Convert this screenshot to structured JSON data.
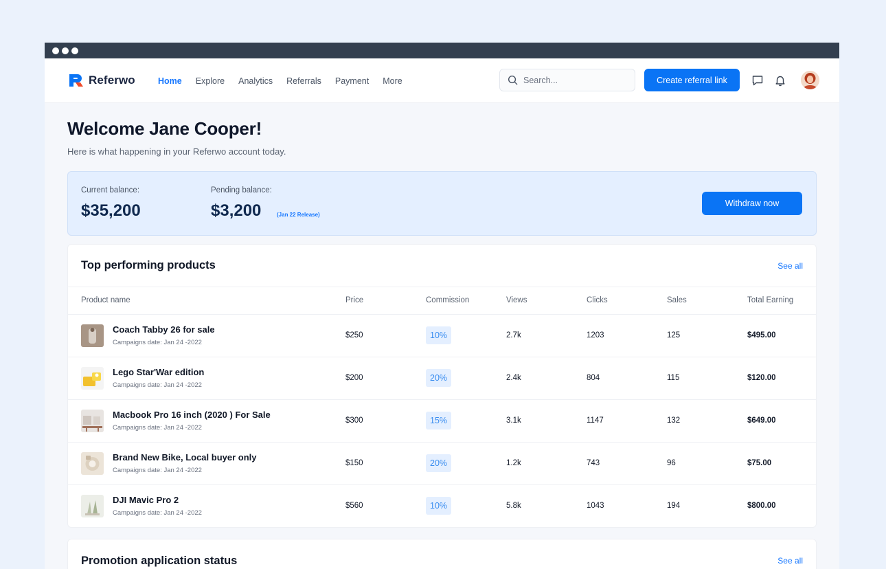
{
  "brand": {
    "name": "Referwo",
    "primary_color": "#0a74f5",
    "accent_red": "#f04a2a"
  },
  "nav": {
    "items": [
      {
        "label": "Home",
        "active": true
      },
      {
        "label": "Explore",
        "active": false
      },
      {
        "label": "Analytics",
        "active": false
      },
      {
        "label": "Referrals",
        "active": false
      },
      {
        "label": "Payment",
        "active": false
      },
      {
        "label": "More",
        "active": false
      }
    ]
  },
  "search": {
    "placeholder": "Search...",
    "icon": "search-icon"
  },
  "header_actions": {
    "create_label": "Create referral link",
    "icons": [
      "message-icon",
      "bell-icon"
    ]
  },
  "welcome": {
    "title": "Welcome Jane Cooper!",
    "subtitle": "Here is what happening in your Referwo account today."
  },
  "balance": {
    "current_label": "Current balance:",
    "current_value": "$35,200",
    "pending_label": "Pending balance:",
    "pending_value": "$3,200",
    "pending_note": "(Jan 22 Release)",
    "withdraw_label": "Withdraw now"
  },
  "products": {
    "title": "Top performing products",
    "see_all": "See all",
    "columns": [
      "Product name",
      "Price",
      "Commission",
      "Views",
      "Clicks",
      "Sales",
      "Total Earning"
    ],
    "rows": [
      {
        "name": "Coach Tabby 26 for sale",
        "date": "Campaigns date: Jan 24 -2022",
        "price": "$250",
        "commission": "10%",
        "views": "2.7k",
        "clicks": "1203",
        "sales": "125",
        "earning": "$495.00"
      },
      {
        "name": "Lego Star'War edition",
        "date": "Campaigns date: Jan 24 -2022",
        "price": "$200",
        "commission": "20%",
        "views": "2.4k",
        "clicks": "804",
        "sales": "115",
        "earning": "$120.00"
      },
      {
        "name": "Macbook Pro 16 inch (2020 ) For Sale",
        "date": "Campaigns date: Jan 24 -2022",
        "price": "$300",
        "commission": "15%",
        "views": "3.1k",
        "clicks": "1147",
        "sales": "132",
        "earning": "$649.00"
      },
      {
        "name": "Brand New Bike, Local buyer only",
        "date": "Campaigns date: Jan 24 -2022",
        "price": "$150",
        "commission": "20%",
        "views": "1.2k",
        "clicks": "743",
        "sales": "96",
        "earning": "$75.00"
      },
      {
        "name": "DJI Mavic Pro 2",
        "date": "Campaigns date: Jan 24 -2022",
        "price": "$560",
        "commission": "10%",
        "views": "5.8k",
        "clicks": "1043",
        "sales": "194",
        "earning": "$800.00"
      }
    ]
  },
  "promotion": {
    "title": "Promotion application status",
    "see_all": "See all"
  }
}
